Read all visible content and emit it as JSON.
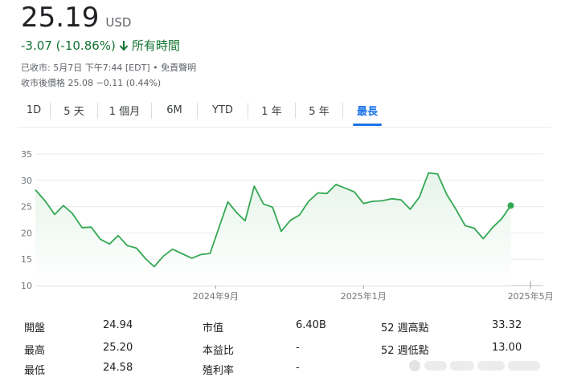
{
  "quote": {
    "price": "25.19",
    "currency": "USD",
    "change": "-3.07 (-10.86%)",
    "period": "所有時間",
    "closed_line": "已收市: 5月7日 下午7:44 [EDT] • 免責聲明",
    "after_hours_line": "收市後價格 25.08 −0.11 (0.44%)"
  },
  "tabs": [
    {
      "label": "1D",
      "active": false
    },
    {
      "label": "5 天",
      "active": false
    },
    {
      "label": "1 個月",
      "active": false
    },
    {
      "label": "6M",
      "active": false
    },
    {
      "label": "YTD",
      "active": false
    },
    {
      "label": "1 年",
      "active": false
    },
    {
      "label": "5 年",
      "active": false
    },
    {
      "label": "最長",
      "active": true
    }
  ],
  "colors": {
    "line": "#34a853",
    "fill_top": "#e6f4ea",
    "grid": "#e8eaed",
    "positive": "#137333",
    "accent": "#1a73e8"
  },
  "chart_data": {
    "type": "area",
    "ylim": [
      10,
      35
    ],
    "yticks": [
      10,
      15,
      20,
      25,
      30,
      35
    ],
    "xticks": [
      {
        "label": "2024年9月",
        "t": 0.355
      },
      {
        "label": "2025年1月",
        "t": 0.646
      },
      {
        "label": "2025年5月",
        "t": 0.975
      }
    ],
    "points": [
      [
        0.0,
        28.2
      ],
      [
        0.02,
        26.0
      ],
      [
        0.038,
        23.5
      ],
      [
        0.055,
        25.2
      ],
      [
        0.072,
        23.8
      ],
      [
        0.092,
        21.0
      ],
      [
        0.11,
        21.1
      ],
      [
        0.128,
        18.8
      ],
      [
        0.146,
        17.9
      ],
      [
        0.163,
        19.5
      ],
      [
        0.181,
        17.6
      ],
      [
        0.199,
        17.1
      ],
      [
        0.217,
        15.1
      ],
      [
        0.234,
        13.6
      ],
      [
        0.252,
        15.6
      ],
      [
        0.27,
        16.9
      ],
      [
        0.288,
        16.1
      ],
      [
        0.308,
        15.2
      ],
      [
        0.326,
        15.9
      ],
      [
        0.344,
        16.1
      ],
      [
        0.361,
        20.9
      ],
      [
        0.379,
        25.9
      ],
      [
        0.397,
        23.8
      ],
      [
        0.413,
        22.3
      ],
      [
        0.431,
        28.9
      ],
      [
        0.449,
        25.5
      ],
      [
        0.467,
        24.9
      ],
      [
        0.484,
        20.3
      ],
      [
        0.502,
        22.4
      ],
      [
        0.52,
        23.4
      ],
      [
        0.538,
        26.0
      ],
      [
        0.556,
        27.6
      ],
      [
        0.574,
        27.5
      ],
      [
        0.592,
        29.2
      ],
      [
        0.61,
        28.5
      ],
      [
        0.628,
        27.8
      ],
      [
        0.646,
        25.6
      ],
      [
        0.664,
        26.0
      ],
      [
        0.682,
        26.1
      ],
      [
        0.702,
        26.5
      ],
      [
        0.72,
        26.3
      ],
      [
        0.738,
        24.5
      ],
      [
        0.756,
        26.8
      ],
      [
        0.774,
        31.4
      ],
      [
        0.792,
        31.2
      ],
      [
        0.81,
        27.3
      ],
      [
        0.828,
        24.5
      ],
      [
        0.846,
        21.4
      ],
      [
        0.864,
        20.9
      ],
      [
        0.882,
        18.9
      ],
      [
        0.9,
        21.0
      ],
      [
        0.918,
        22.7
      ],
      [
        0.936,
        25.2
      ]
    ]
  },
  "stats": [
    {
      "label": "開盤",
      "value": "24.94"
    },
    {
      "label": "最高",
      "value": "25.20"
    },
    {
      "label": "最低",
      "value": "24.58"
    },
    {
      "label": "市值",
      "value": "6.40B"
    },
    {
      "label": "本益比",
      "value": "-"
    },
    {
      "label": "殖利率",
      "value": "-"
    },
    {
      "label": "52 週高點",
      "value": "33.32"
    },
    {
      "label": "52 週低點",
      "value": "13.00"
    }
  ]
}
